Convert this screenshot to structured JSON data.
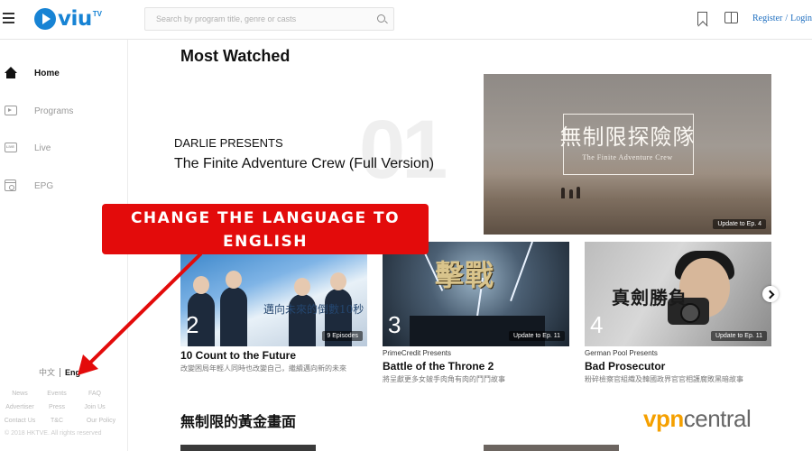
{
  "header": {
    "menu_icon": "hamburger-icon",
    "logo_text": "viu",
    "logo_suffix": "TV",
    "search_placeholder": "Search by program title, genre or casts",
    "bookmark_icon": "bookmark-icon",
    "book_icon": "book-icon",
    "register_label": "Register",
    "auth_separator": "/",
    "login_label": "Login"
  },
  "sidebar": {
    "items": [
      {
        "label": "Home",
        "icon": "home-icon",
        "active": true
      },
      {
        "label": "Programs",
        "icon": "tv-icon",
        "active": false
      },
      {
        "label": "Live",
        "icon": "live-icon",
        "active": false
      },
      {
        "label": "EPG",
        "icon": "calendar-icon",
        "active": false
      }
    ],
    "lang_zh": "中文",
    "lang_en": "Eng",
    "footer_rows": [
      [
        "News",
        "Events",
        "FAQ"
      ],
      [
        "Advertiser",
        "Press",
        "Join Us"
      ],
      [
        "Contact Us",
        "T&C",
        "Our Policy"
      ]
    ],
    "copyright": "© 2018 HKTVE. All rights reserved"
  },
  "main": {
    "section_title": "Most Watched",
    "hero": {
      "rank": "01",
      "presenter": "DARLIE PRESENTS",
      "title": "The Finite Adventure Crew (Full Version)",
      "image_title_cn": "無制限探險隊",
      "image_title_en": "The Finite Adventure Crew",
      "badge": "Update to Ep. 4"
    },
    "cards": [
      {
        "rank": "2",
        "sub": "",
        "title": "10 Count to the Future",
        "desc": "改變困局年輕人同時也改變自己，繼續邁向新的未來",
        "badge": "9 Episodes",
        "image_text": "邁向未來的倒數10秒"
      },
      {
        "rank": "3",
        "sub": "PrimeCredit Presents",
        "title": "Battle of the Throne 2",
        "desc": "將呈獻更多女皴手肉角有肉的鬥鬥故事",
        "badge": "Update to Ep. 11",
        "image_text": "擊戰"
      },
      {
        "rank": "4",
        "sub": "German Pool Presents",
        "title": "Bad Prosecutor",
        "desc": "粉碎檢察官組織及韓國政界官官相護腐敗黑暗故事",
        "badge": "Update to Ep. 11",
        "image_text": "真劍勝負"
      }
    ],
    "next_icon": "chevron-right-icon",
    "section2_title": "無制限的黃金畫面"
  },
  "annotation": {
    "line1": "CHANGE THE LANGUAGE TO",
    "line2": "ENGLISH",
    "color": "#e30b0b"
  },
  "watermark": {
    "part_a": "vpn",
    "part_b": "central"
  }
}
